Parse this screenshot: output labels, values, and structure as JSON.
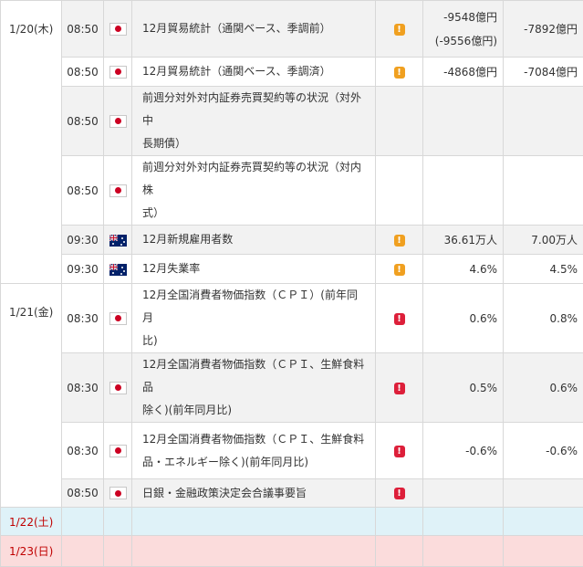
{
  "days": [
    {
      "date": "1/20(木)"
    },
    {
      "date": "1/21(金)"
    },
    {
      "date": "1/22(土)"
    },
    {
      "date": "1/23(日)"
    }
  ],
  "rows": [
    {
      "time": "08:50",
      "country": "Japan",
      "event": "12月貿易統計（通関ベース、季調前）",
      "importance": "medium",
      "importance_glyph": "!",
      "actual": "-9548億円",
      "actual_revised": "(-9556億円)",
      "forecast": "-7892億円"
    },
    {
      "time": "08:50",
      "country": "Japan",
      "event": "12月貿易統計（通関ベース、季調済）",
      "importance": "medium",
      "importance_glyph": "!",
      "actual": "-4868億円",
      "forecast": "-7084億円"
    },
    {
      "time": "08:50",
      "country": "Japan",
      "event_line1": "前週分対外対内証券売買契約等の状況（対外中",
      "event_line2": "長期債）"
    },
    {
      "time": "08:50",
      "country": "Japan",
      "event_line1": "前週分対外対内証券売買契約等の状況（対内株",
      "event_line2": "式）"
    },
    {
      "time": "09:30",
      "country": "Australia",
      "event": "12月新規雇用者数",
      "importance": "medium",
      "importance_glyph": "!",
      "actual": "36.61万人",
      "forecast": "7.00万人"
    },
    {
      "time": "09:30",
      "country": "Australia",
      "event": "12月失業率",
      "importance": "medium",
      "importance_glyph": "!",
      "actual": "4.6%",
      "forecast": "4.5%"
    },
    {
      "time": "08:30",
      "country": "Japan",
      "event_line1": "12月全国消費者物価指数（ＣＰＩ）(前年同月",
      "event_line2": "比)",
      "importance": "high",
      "importance_glyph": "!",
      "actual": "0.6%",
      "forecast": "0.8%"
    },
    {
      "time": "08:30",
      "country": "Japan",
      "event_line1": "12月全国消費者物価指数（ＣＰＩ、生鮮食料品",
      "event_line2": "除く)(前年同月比)",
      "importance": "high",
      "importance_glyph": "!",
      "actual": "0.5%",
      "forecast": "0.6%"
    },
    {
      "time": "08:30",
      "country": "Japan",
      "event_line1": "12月全国消費者物価指数（ＣＰＩ、生鮮食料",
      "event_line2": "品・エネルギー除く)(前年同月比)",
      "importance": "high",
      "importance_glyph": "!",
      "actual": "-0.6%",
      "forecast": "-0.6%"
    },
    {
      "time": "08:50",
      "country": "Japan",
      "event": "日銀・金融政策決定会合議事要旨",
      "importance": "high",
      "importance_glyph": "!"
    }
  ],
  "colors": {
    "medium_importance": "#f0a020",
    "high_importance": "#dd1f3a",
    "weekend_date_text": "#c00000",
    "saturday_bg": "#dff2f8",
    "sunday_bg": "#fbdcdc",
    "alt_row_bg": "#f2f2f2"
  }
}
